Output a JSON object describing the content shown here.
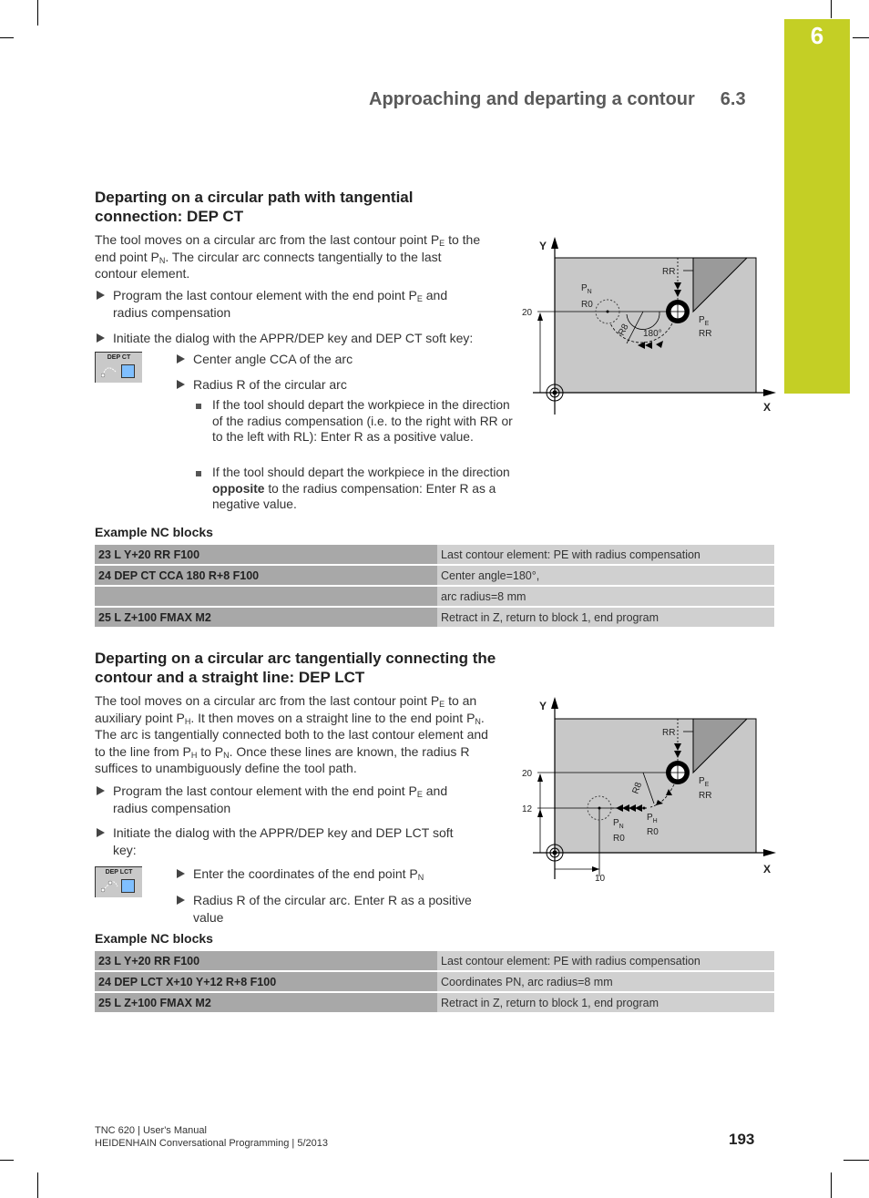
{
  "header": {
    "chapter_number": "6",
    "running_title": "Approaching and departing a contour",
    "section_number": "6.3",
    "accent_color": "#c4cf25"
  },
  "section1": {
    "heading_line1": "Departing on a circular path with tangential",
    "heading_line2": "connection: DEP CT",
    "intro": {
      "t1": "The tool moves on a circular arc from the last contour point P",
      "s1": "E",
      "t2": " to the end point P",
      "s2": "N",
      "t3": ". The circular arc connects tangentially to the last contour element."
    },
    "steps": [
      {
        "t1": "Program the last contour element with the end point P",
        "s1": "E",
        "t2": " and radius compensation"
      },
      {
        "text": "Initiate the dialog with the APPR/DEP key and DEP CT soft key:"
      }
    ],
    "softkey_label": "DEP CT",
    "softkey_icon": "dep-ct-softkey-icon",
    "sub_steps": [
      "Center angle CCA of the arc",
      "Radius R of the circular arc"
    ],
    "notes": [
      {
        "text": "If the tool should depart the workpiece in the direction of the radius compensation (i.e. to the right with RR or to the left with RL): Enter R as a positive value."
      },
      {
        "t1": "If the tool should depart the workpiece in the direction ",
        "bold": "opposite",
        "t2": " to the radius compensation: Enter R as a negative value."
      }
    ],
    "example_heading": "Example NC blocks",
    "nc_blocks": [
      {
        "code": "23 L Y+20 RR F100",
        "desc": "Last contour element: PE with radius compensation"
      },
      {
        "code": "24 DEP CT CCA 180 R+8 F100",
        "desc": "Center angle=180°,"
      },
      {
        "code": "",
        "desc": "arc radius=8 mm"
      },
      {
        "code": "25 L Z+100 FMAX M2",
        "desc": "Retract in Z, return to block 1, end program"
      }
    ],
    "figure": {
      "axis_y": "Y",
      "axis_x": "X",
      "y_tick": "20",
      "label_rr_top": "RR",
      "label_pn": "P",
      "label_pn_sub": "N",
      "label_r0": "R0",
      "label_r8": "R8",
      "label_angle": "180°",
      "label_pe": "P",
      "label_pe_sub": "E",
      "label_rr": "RR"
    }
  },
  "section2": {
    "heading_line1": "Departing on a circular arc tangentially connecting the",
    "heading_line2": "contour and a straight line: DEP LCT",
    "intro": {
      "t1": "The tool moves on a circular arc from the last contour point P",
      "s1": "E",
      "t2": " to an auxiliary point P",
      "s2": "H",
      "t3": ". It then moves on a straight line to the end point P",
      "s3": "N",
      "t4": ". The arc is tangentially connected both to the last contour element and to the line from P",
      "s4": "H",
      "t5": " to P",
      "s5": "N",
      "t6": ". Once these lines are known, the radius R suffices to unambiguously define the tool path."
    },
    "steps": [
      {
        "t1": "Program the last contour element with the end point P",
        "s1": "E",
        "t2": " and radius compensation"
      },
      {
        "text": "Initiate the dialog with the APPR/DEP key and DEP LCT soft key:"
      }
    ],
    "softkey_label": "DEP LCT",
    "softkey_icon": "dep-lct-softkey-icon",
    "sub_steps": [
      {
        "t1": "Enter the coordinates of the end point P",
        "s1": "N"
      },
      {
        "text": "Radius R of the circular arc. Enter R as a positive value"
      }
    ],
    "example_heading": "Example NC blocks",
    "nc_blocks": [
      {
        "code": "23 L Y+20 RR F100",
        "desc": "Last contour element: PE with radius compensation"
      },
      {
        "code": "24 DEP LCT X+10 Y+12 R+8 F100",
        "desc": "Coordinates PN, arc radius=8 mm"
      },
      {
        "code": "25 L Z+100 FMAX M2",
        "desc": "Retract in Z, return to block 1, end program"
      }
    ],
    "figure": {
      "axis_y": "Y",
      "axis_x": "X",
      "y_tick_20": "20",
      "y_tick_12": "12",
      "x_tick_10": "10",
      "label_rr_top": "RR",
      "label_r8": "R8",
      "label_pe": "P",
      "label_pe_sub": "E",
      "label_rr": "RR",
      "label_pn": "P",
      "label_pn_sub": "N",
      "label_pn_r0": "R0",
      "label_ph": "P",
      "label_ph_sub": "H",
      "label_ph_r0": "R0"
    }
  },
  "footer": {
    "line1": "TNC 620 | User's Manual",
    "line2": "HEIDENHAIN Conversational Programming | 5/2013",
    "page_number": "193"
  }
}
